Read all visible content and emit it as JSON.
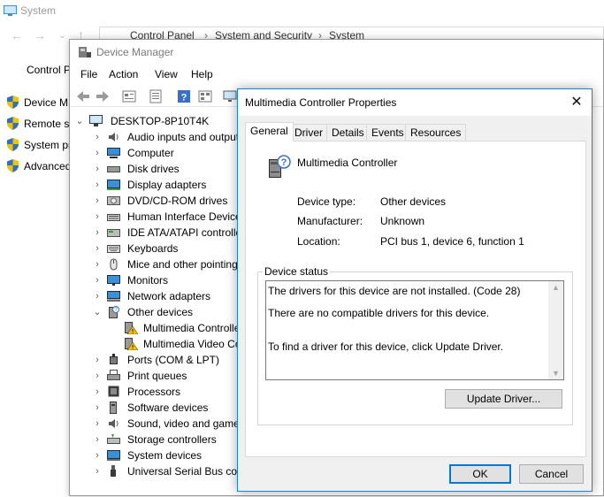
{
  "system_window": {
    "title": "System",
    "address": [
      "Control Panel",
      "System and Security",
      "System"
    ],
    "home_link": "Control P",
    "links": [
      {
        "label": "Device M",
        "icon": "shield-icon"
      },
      {
        "label": "Remote s",
        "icon": "shield-icon"
      },
      {
        "label": "System pr",
        "icon": "shield-icon"
      },
      {
        "label": "Advanced",
        "icon": "shield-icon"
      }
    ]
  },
  "device_manager": {
    "title": "Device Manager",
    "menu": [
      "File",
      "Action",
      "View",
      "Help"
    ],
    "root": "DESKTOP-8P10T4K",
    "tree": [
      {
        "label": "Audio inputs and outputs",
        "icon": "speaker-icon",
        "expanded": false
      },
      {
        "label": "Computer",
        "icon": "computer-icon",
        "expanded": false
      },
      {
        "label": "Disk drives",
        "icon": "disk-drive-icon",
        "expanded": false
      },
      {
        "label": "Display adapters",
        "icon": "display-adapter-icon",
        "expanded": false
      },
      {
        "label": "DVD/CD-ROM drives",
        "icon": "dvd-drive-icon",
        "expanded": false
      },
      {
        "label": "Human Interface Devices",
        "icon": "hid-icon",
        "expanded": false
      },
      {
        "label": "IDE ATA/ATAPI controllers",
        "icon": "ide-controller-icon",
        "expanded": false
      },
      {
        "label": "Keyboards",
        "icon": "keyboard-icon",
        "expanded": false
      },
      {
        "label": "Mice and other pointing devices",
        "icon": "mouse-icon",
        "expanded": false
      },
      {
        "label": "Monitors",
        "icon": "monitor-icon",
        "expanded": false
      },
      {
        "label": "Network adapters",
        "icon": "network-adapter-icon",
        "expanded": false
      },
      {
        "label": "Other devices",
        "icon": "other-devices-icon",
        "expanded": true,
        "children": [
          {
            "label": "Multimedia Controller",
            "icon": "warning-device-icon"
          },
          {
            "label": "Multimedia Video Controller",
            "icon": "warning-device-icon"
          }
        ]
      },
      {
        "label": "Ports (COM & LPT)",
        "icon": "port-icon",
        "expanded": false
      },
      {
        "label": "Print queues",
        "icon": "printer-icon",
        "expanded": false
      },
      {
        "label": "Processors",
        "icon": "processor-icon",
        "expanded": false
      },
      {
        "label": "Software devices",
        "icon": "software-device-icon",
        "expanded": false
      },
      {
        "label": "Sound, video and game controllers",
        "icon": "speaker-icon",
        "expanded": false
      },
      {
        "label": "Storage controllers",
        "icon": "storage-controller-icon",
        "expanded": false
      },
      {
        "label": "System devices",
        "icon": "system-devices-icon",
        "expanded": false
      },
      {
        "label": "Universal Serial Bus controllers",
        "icon": "usb-icon",
        "expanded": false
      }
    ]
  },
  "dialog": {
    "title": "Multimedia Controller Properties",
    "close_glyph": "✕",
    "tabs": [
      "General",
      "Driver",
      "Details",
      "Events",
      "Resources"
    ],
    "active_tab": "General",
    "device_name": "Multimedia Controller",
    "properties": [
      {
        "label": "Device type:",
        "value": "Other devices"
      },
      {
        "label": "Manufacturer:",
        "value": "Unknown"
      },
      {
        "label": "Location:",
        "value": "PCI bus 1, device 6, function 1"
      }
    ],
    "status_legend": "Device status",
    "status_lines": [
      "The drivers for this device are not installed. (Code 28)",
      "There are no compatible drivers for this device.",
      "To find a driver for this device, click Update Driver."
    ],
    "update_driver_label": "Update Driver...",
    "ok_label": "OK",
    "cancel_label": "Cancel"
  },
  "colors": {
    "accent": "#0078d7",
    "warning": "#f5c000"
  }
}
